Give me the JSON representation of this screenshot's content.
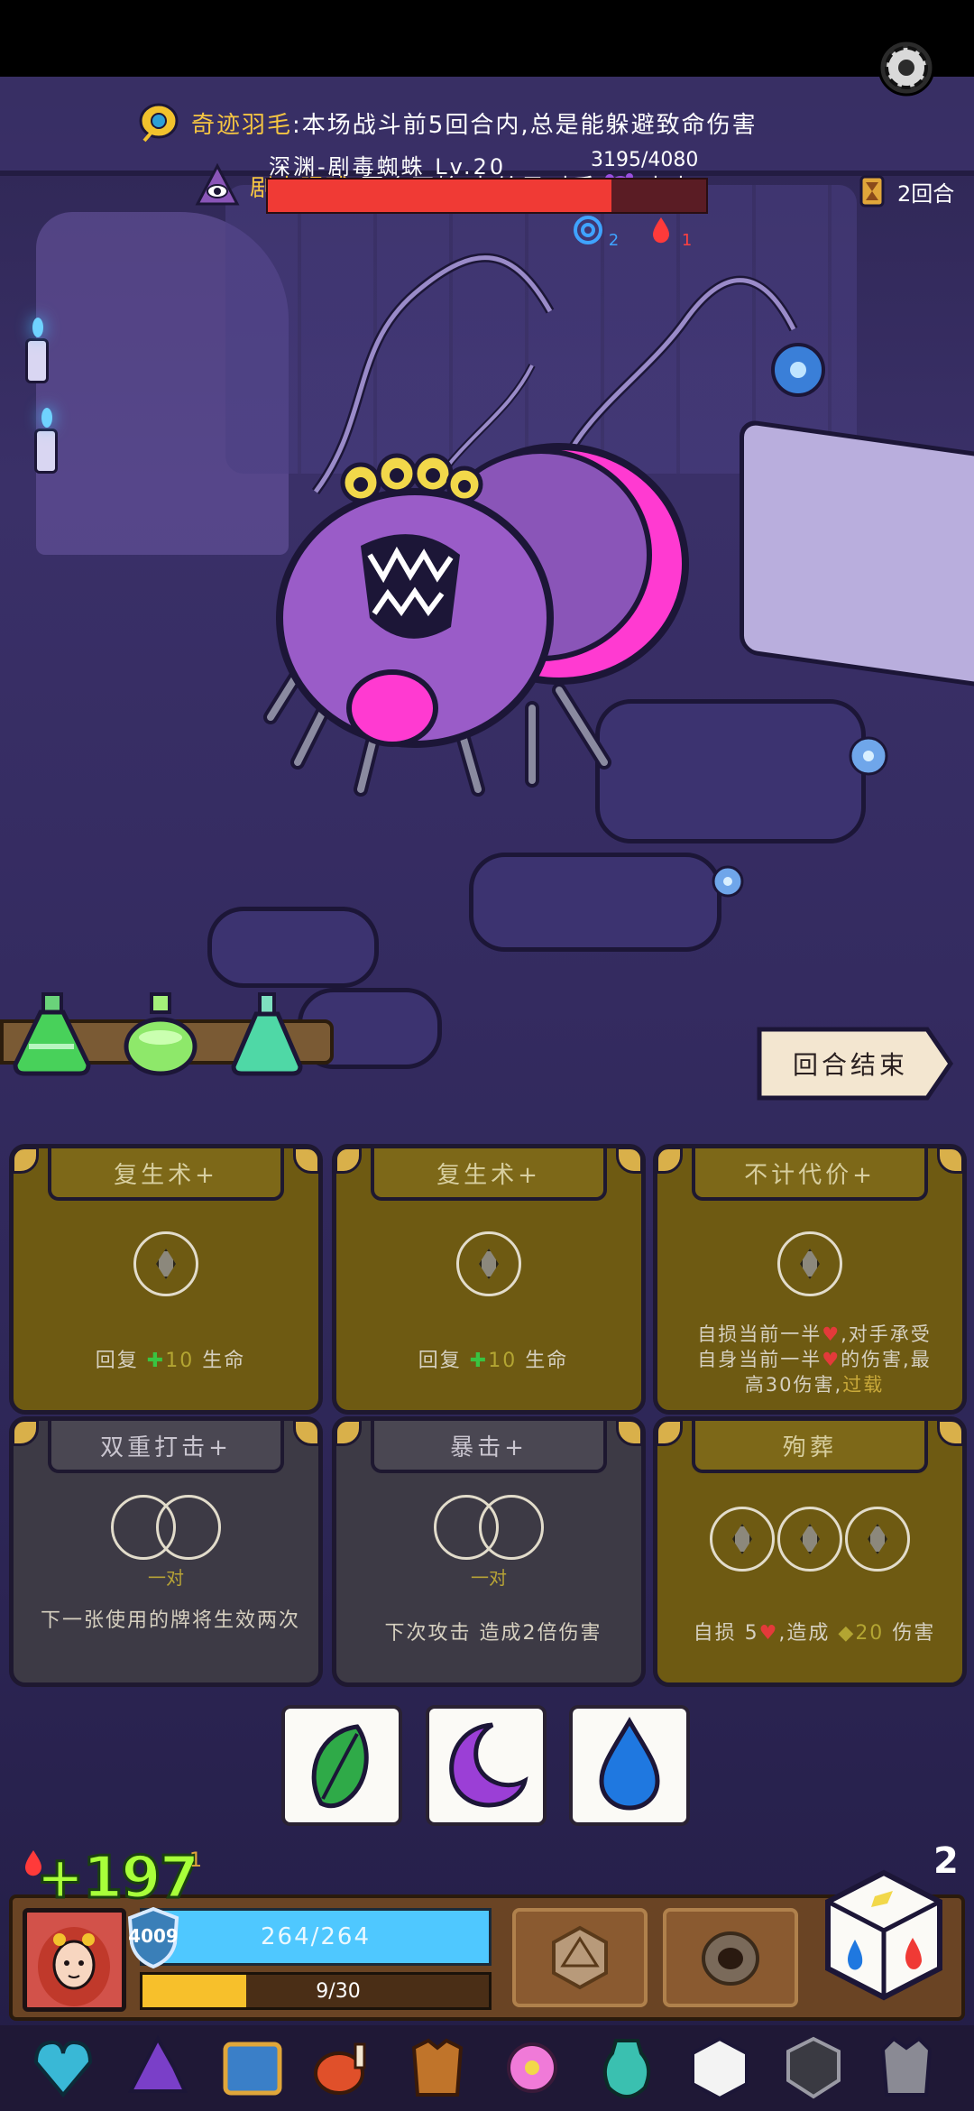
{
  "buffs": [
    {
      "name": "奇迹羽毛",
      "desc": ":本场战斗前5回合内,总是能躲避致命伤害"
    },
    {
      "name": "剧毒眼球",
      "desc": ":回合开始时,给予对手",
      "tail": "中毒"
    }
  ],
  "enemy": {
    "name": "深渊-剧毒蜘蛛 Lv.20",
    "hp_text": "3195/4080",
    "hp_current": 3195,
    "hp_max": 4080,
    "status": {
      "blue_count": "2",
      "red_count": "1"
    }
  },
  "turn": {
    "label": "2回合"
  },
  "end_turn_button": {
    "label": "回合结束"
  },
  "cards": [
    {
      "title": "复生术+",
      "desc_a": "回复",
      "amount": "10",
      "desc_b": "生命"
    },
    {
      "title": "复生术+",
      "desc_a": "回复",
      "amount": "10",
      "desc_b": "生命"
    },
    {
      "title": "不计代价+",
      "desc_line1a": "自损当前一半",
      "desc_line1b": ",对手承受",
      "desc_line2a": "自身当前一半",
      "desc_line2b": "的伤害,最",
      "desc_line3a": "高30伤害,",
      "desc_line3b": "过载"
    },
    {
      "title": "双重打击+",
      "pair_label": "一对",
      "desc": "下一张使用的牌将生效两次"
    },
    {
      "title": "暴击+",
      "pair_label": "一对",
      "desc": "下次攻击 造成2倍伤害"
    },
    {
      "title": "殉葬",
      "desc_a": "自损 5",
      "desc_b": ",造成",
      "amount": "20",
      "desc_c": "伤害"
    }
  ],
  "player": {
    "hp_text": "264/264",
    "shield": "4009",
    "xp_text": "9/30",
    "xp_fraction": 0.3,
    "heal_popup": "+197",
    "status_count": "1"
  },
  "dice": {
    "count": "2"
  },
  "colors": {
    "accent_gold": "#f5c542",
    "enemy_hp": "#f03a35",
    "player_hp": "#4fc8ff",
    "xp": "#f7c02b"
  },
  "inventory_icons": [
    "crystal-heart-icon",
    "wizard-hat-icon",
    "map-scroll-icon",
    "meat-leg-icon",
    "leather-armor-icon",
    "lotus-flower-icon",
    "teal-vase-icon",
    "white-die-icon",
    "dark-shield-icon",
    "spiked-armor-icon"
  ]
}
